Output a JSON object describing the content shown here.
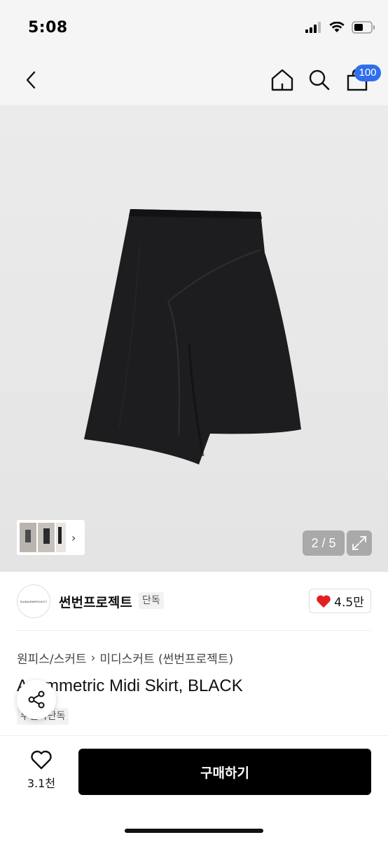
{
  "status": {
    "time": "5:08"
  },
  "nav": {
    "back_icon": "chevron-left-icon",
    "home_icon": "home-icon",
    "search_icon": "search-icon",
    "bag_icon": "shopping-bag-icon",
    "bag_badge": "100",
    "badge_color": "#2f6fed"
  },
  "gallery": {
    "page_counter": "2 / 5",
    "expand_icon": "expand-icon",
    "thumb_arrow": "›"
  },
  "brand": {
    "logo_text": "SUNBURNPROJECT",
    "name": "썬번프로젝트",
    "badge": "단독",
    "likes": "4.5만",
    "heart_color": "#e02020"
  },
  "product": {
    "breadcrumb": [
      "원피스/스커트",
      "미디스커트 (썬번프로젝트)"
    ],
    "breadcrumb_sep": "›",
    "title": "Asymmetric Midi Skirt, BLACK",
    "tag": "무신사단독"
  },
  "bottom": {
    "wish_count": "3.1천",
    "buy_label": "구매하기"
  }
}
